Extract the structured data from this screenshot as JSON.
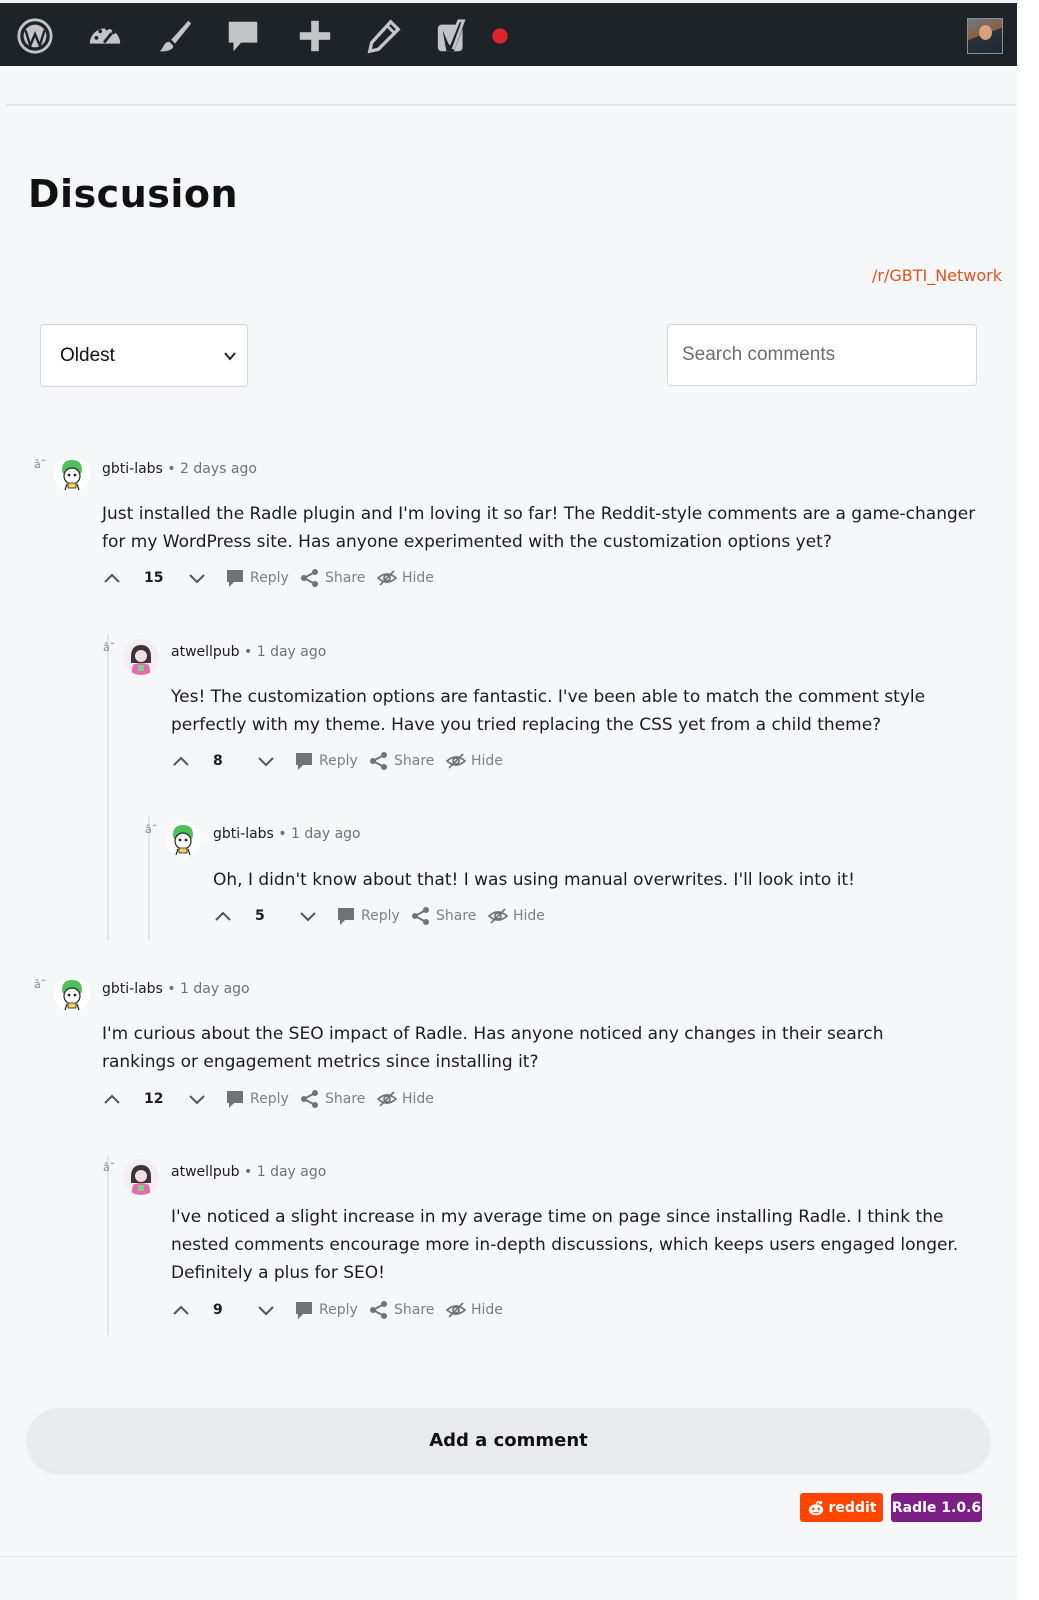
{
  "admin_bar": {
    "icons": [
      "wordpress-logo-icon",
      "dashboard-icon",
      "customize-icon",
      "comments-icon",
      "new-content-icon",
      "edit-icon",
      "yoast-icon",
      "status-dot-icon"
    ],
    "status_dot_color": "#e0242b"
  },
  "page": {
    "title": "Discusion"
  },
  "subreddit_link": "/r/GBTI_Network",
  "controls": {
    "sort_value": "Oldest",
    "search_placeholder": "Search comments"
  },
  "actions": {
    "reply": "Reply",
    "share": "Share",
    "hide": "Hide"
  },
  "comments": [
    {
      "author": "gbti-labs",
      "ago": "• 2 days ago",
      "body": "Just installed the Radle plugin and I'm loving it so far! The Reddit-style comments are a game-changer for my WordPress site. Has anyone experimented with the customization options yet?",
      "score": "15",
      "glyph": "â˜"
    },
    {
      "author": "atwellpub",
      "ago": "• 1 day ago",
      "body": "Yes! The customization options are fantastic. I've been able to match the comment style perfectly with my theme. Have you tried replacing the CSS yet from a child theme?",
      "score": "8",
      "glyph": "â˜"
    },
    {
      "author": "gbti-labs",
      "ago": "• 1 day ago",
      "body": "Oh, I didn't know about that! I was using manual overwrites. I'll look into it!",
      "score": "5",
      "glyph": "â˜"
    },
    {
      "author": "gbti-labs",
      "ago": "• 1 day ago",
      "body": "I'm curious about the SEO impact of Radle. Has anyone noticed any changes in their search rankings or engagement metrics since installing it?",
      "score": "12",
      "glyph": "â˜"
    },
    {
      "author": "atwellpub",
      "ago": "• 1 day ago",
      "body": "I've noticed a slight increase in my average time on page since installing Radle. I think the nested comments encourage more in-depth discussions, which keeps users engaged longer. Definitely a plus for SEO!",
      "score": "9",
      "glyph": "â˜"
    }
  ],
  "add_comment_label": "Add a comment",
  "badges": {
    "reddit": "reddit",
    "radle": "Radle 1.0.6"
  },
  "colors": {
    "accent_link": "#e0531f",
    "reddit": "#ff4500",
    "radle": "#7b1e86",
    "admin_bar": "#1d2327"
  }
}
